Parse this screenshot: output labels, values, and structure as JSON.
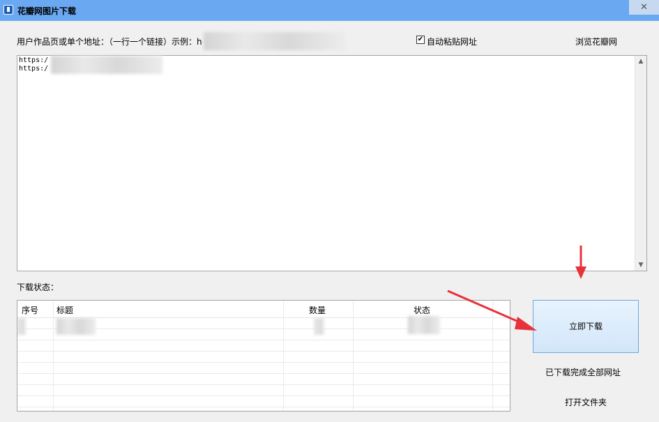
{
  "window": {
    "title": "花瓣网图片下载",
    "close_glyph": "✕"
  },
  "form": {
    "url_label": "用户作品页或单个地址：（一行一个链接）示例：h",
    "auto_paste": {
      "checked": true,
      "check_glyph": "✔",
      "label": "自动粘贴网址"
    },
    "browse_link": "浏览花瓣网",
    "urls": [
      "https:/",
      "https:/"
    ]
  },
  "status": {
    "label": "下载状态：",
    "columns": [
      "序号",
      "标题",
      "数量",
      "状态"
    ]
  },
  "actions": {
    "download": "立即下载",
    "downloaded_all": "已下载完成全部网址",
    "open_folder": "打开文件夹"
  },
  "colors": {
    "titlebar": "#6aa8f1",
    "annotation_arrow": "#e8323a"
  }
}
